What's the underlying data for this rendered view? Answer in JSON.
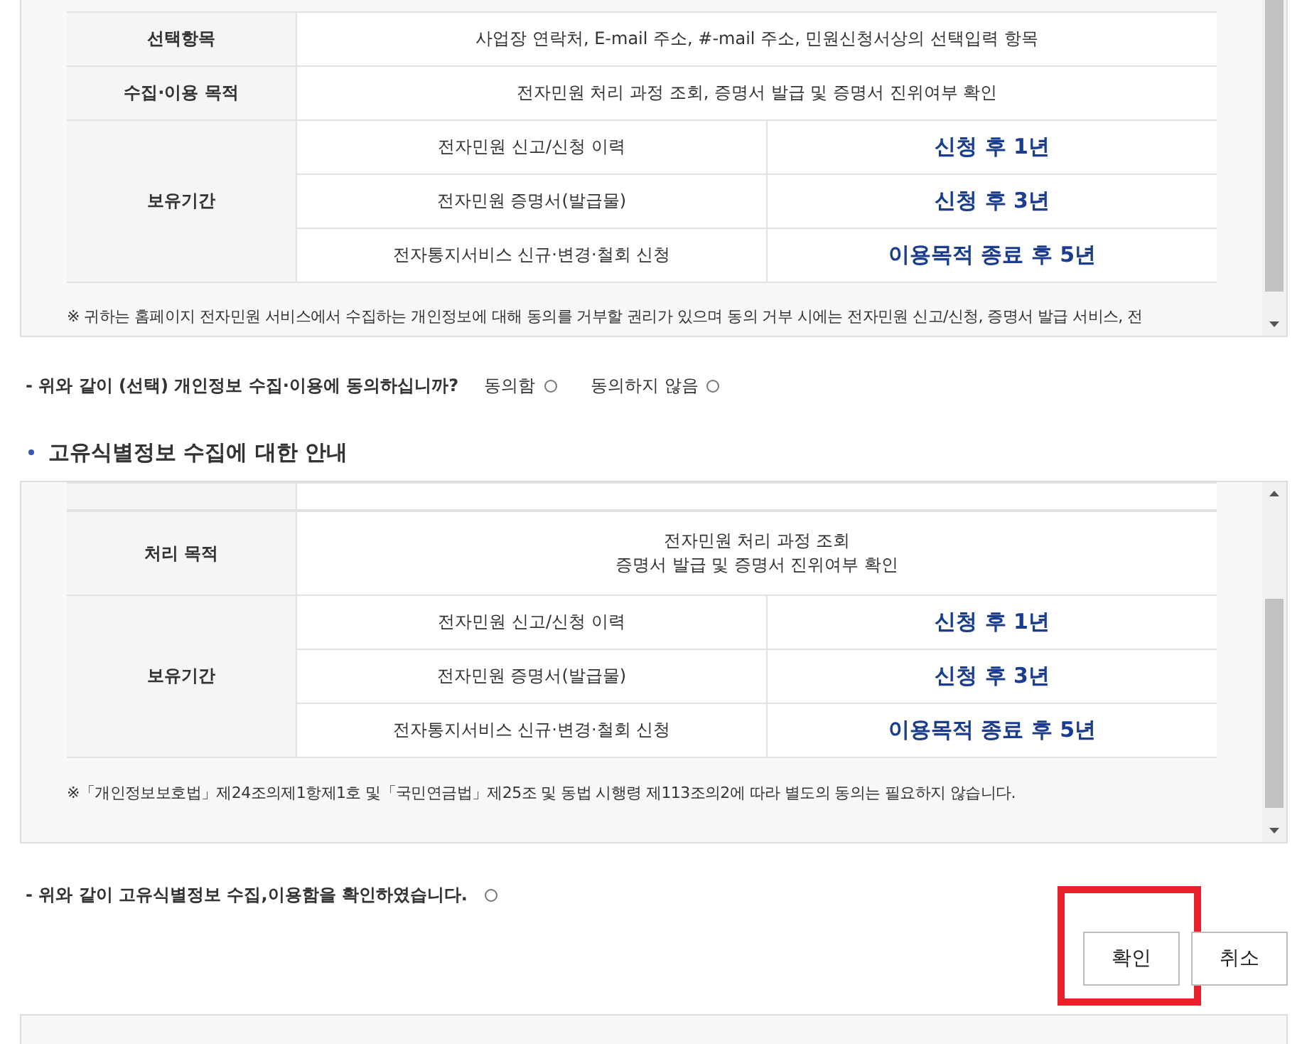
{
  "consent_box": {
    "rows": [
      {
        "kind": "text",
        "label": "선택항목",
        "lines": [
          "사업장 연락처, E-mail 주소, #-mail 주소, 민원신청서상의 선택입력 항목"
        ]
      },
      {
        "kind": "text",
        "label": "수집·이용 목적",
        "lines": [
          "전자민원 처리 과정 조회, 증명서 발급 및 증명서 진위여부 확인"
        ]
      },
      {
        "kind": "periods",
        "label": "보유기간",
        "items": [
          {
            "name": "전자민원 신고/신청 이력",
            "period": "신청 후 1년"
          },
          {
            "name": "전자민원 증명서(발급물)",
            "period": "신청 후 3년"
          },
          {
            "name": "전자통지서비스 신규·변경·철회 신청",
            "period": "이용목적 종료 후 5년"
          }
        ]
      }
    ],
    "notes": [
      "※ 귀하는 홈페이지 전자민원 서비스에서 수집하는 개인정보에 대해 동의를 거부할 권리가 있으며 동의 거부 시에는 전자민원 신고/신청, 증명서 발급 서비스, 전"
    ]
  },
  "consent_question": {
    "text": "- 위와 같이 (선택) 개인정보 수집·이용에 동의하십니까?",
    "options": [
      {
        "label": "동의함",
        "selected": false
      },
      {
        "label": "동의하지 않음",
        "selected": false
      }
    ]
  },
  "section_heading": "고유식별정보 수집에 대한 안내",
  "unique_id_box": {
    "rows": [
      {
        "kind": "text",
        "label": "처리 목적",
        "lines": [
          "전자민원 처리 과정 조회",
          "증명서 발급 및 증명서 진위여부 확인"
        ]
      },
      {
        "kind": "periods",
        "label": "보유기간",
        "items": [
          {
            "name": "전자민원 신고/신청 이력",
            "period": "신청 후 1년"
          },
          {
            "name": "전자민원 증명서(발급물)",
            "period": "신청 후 3년"
          },
          {
            "name": "전자통지서비스 신규·변경·철회 신청",
            "period": "이용목적 종료 후 5년"
          }
        ]
      }
    ],
    "notes": [
      "※「개인정보보호법」제24조의제1항제1호 및「국민연금법」제25조 및 동법 시행령 제113조의2에 따라 별도의 동의는 필요하지 않습니다."
    ]
  },
  "confirmation": {
    "text": "- 위와 같이 고유식별정보 수집,이용함을 확인하였습니다.",
    "checked": false
  },
  "buttons": [
    {
      "label": "확인",
      "highlighted": true
    },
    {
      "label": "취소",
      "highlighted": false
    }
  ]
}
